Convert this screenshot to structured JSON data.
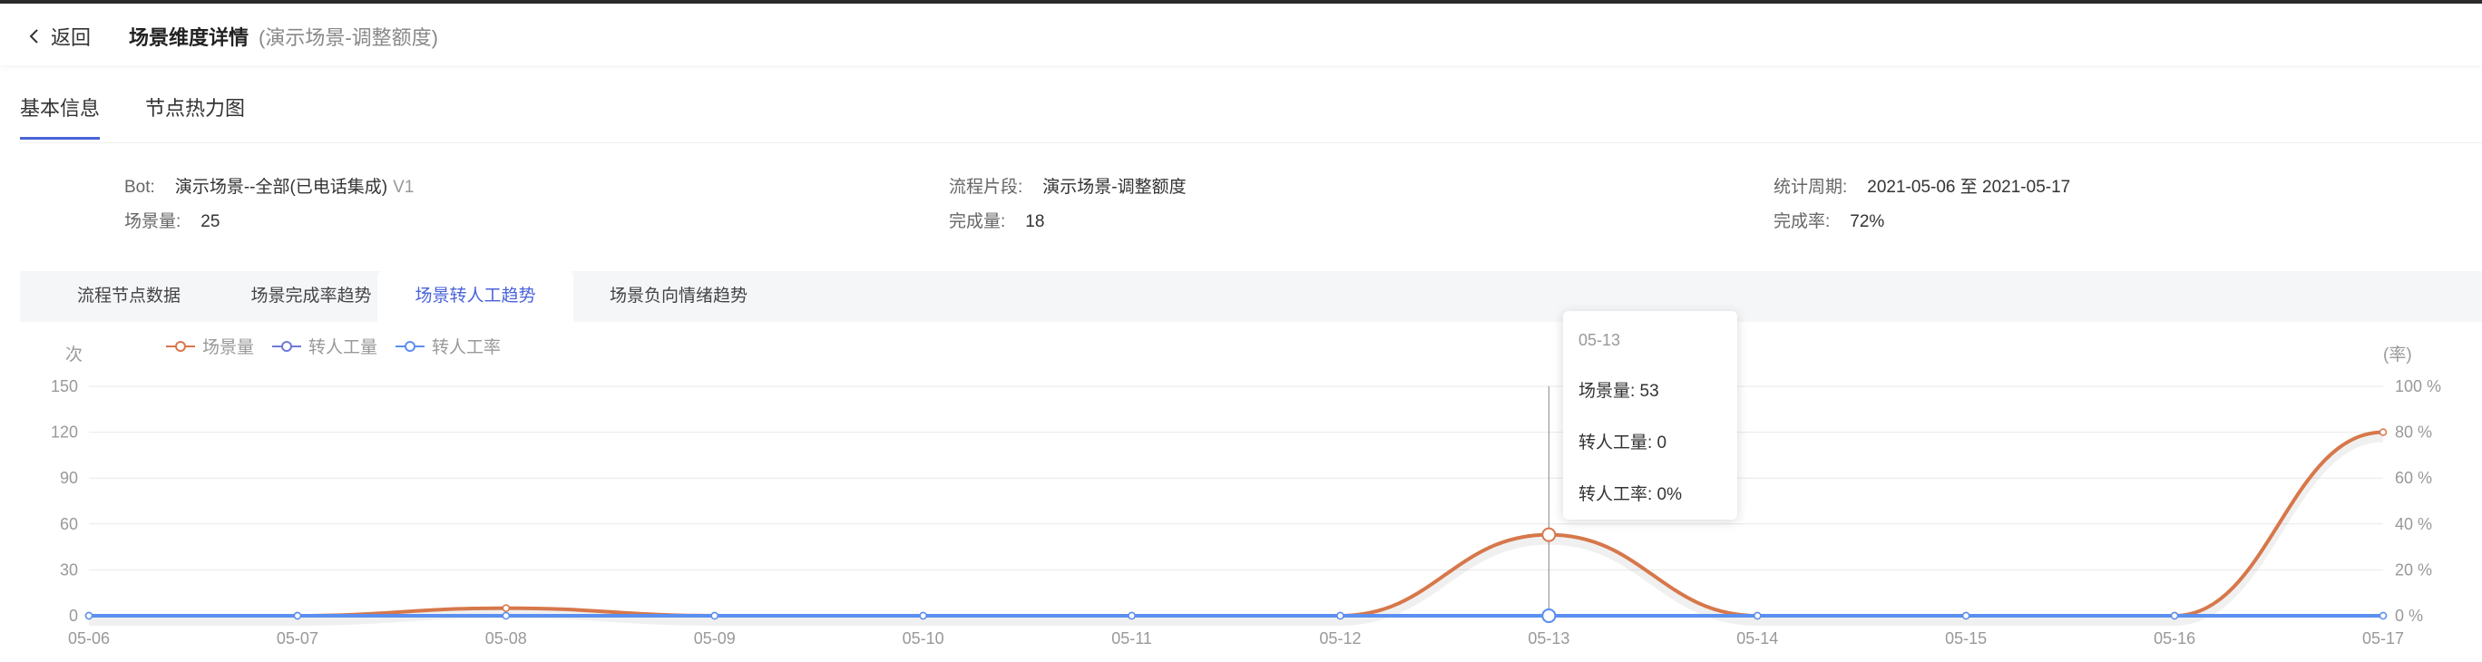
{
  "header": {
    "back_label": "返回",
    "title": "场景维度详情",
    "subtitle": "(演示场景-调整额度)"
  },
  "main_tabs": [
    {
      "label": "基本信息",
      "active": true
    },
    {
      "label": "节点热力图",
      "active": false
    }
  ],
  "info": {
    "bot_label": "Bot:",
    "bot_value": "演示场景--全部(已电话集成)",
    "bot_version": "V1",
    "segment_label": "流程片段:",
    "segment_value": "演示场景-调整额度",
    "period_label": "统计周期:",
    "period_value": "2021-05-06 至 2021-05-17",
    "scene_count_label": "场景量:",
    "scene_count_value": "25",
    "complete_count_label": "完成量:",
    "complete_count_value": "18",
    "complete_rate_label": "完成率:",
    "complete_rate_value": "72%"
  },
  "sub_tabs": [
    {
      "label": "流程节点数据",
      "active": false
    },
    {
      "label": "场景完成率趋势",
      "active": false
    },
    {
      "label": "场景转人工趋势",
      "active": true
    },
    {
      "label": "场景负向情绪趋势",
      "active": false
    }
  ],
  "tooltip": {
    "title": "05-13",
    "rows": [
      "场景量: 53",
      "转人工量: 0",
      "转人工率: 0%"
    ]
  },
  "colors": {
    "accent": "#4a63d8",
    "scene": "#d7774a",
    "transfer": "#6f79d9",
    "rate": "#5b8ff0"
  },
  "chart_data": {
    "type": "line",
    "x": [
      "05-06",
      "05-07",
      "05-08",
      "05-09",
      "05-10",
      "05-11",
      "05-12",
      "05-13",
      "05-14",
      "05-15",
      "05-16",
      "05-17"
    ],
    "left_axis": {
      "label": "次",
      "ticks": [
        "0",
        "30",
        "60",
        "90",
        "120",
        "150"
      ],
      "ylim": [
        0,
        150
      ]
    },
    "right_axis": {
      "label": "(率)",
      "ticks": [
        "0 %",
        "20 %",
        "40 %",
        "60 %",
        "80 %",
        "100 %"
      ],
      "ylim": [
        0,
        100
      ]
    },
    "legend_position": "top-left",
    "grid": true,
    "series": [
      {
        "name": "场景量",
        "axis": "left",
        "color": "#d7774a",
        "values": [
          0,
          0,
          5,
          0,
          0,
          0,
          0,
          53,
          0,
          0,
          0,
          120
        ]
      },
      {
        "name": "转人工量",
        "axis": "left",
        "color": "#6f79d9",
        "values": [
          0,
          0,
          0,
          0,
          0,
          0,
          0,
          0,
          0,
          0,
          0,
          0
        ]
      },
      {
        "name": "转人工率",
        "axis": "right",
        "color": "#5b8ff0",
        "values": [
          0,
          0,
          0,
          0,
          0,
          0,
          0,
          0,
          0,
          0,
          0,
          0
        ]
      }
    ]
  }
}
